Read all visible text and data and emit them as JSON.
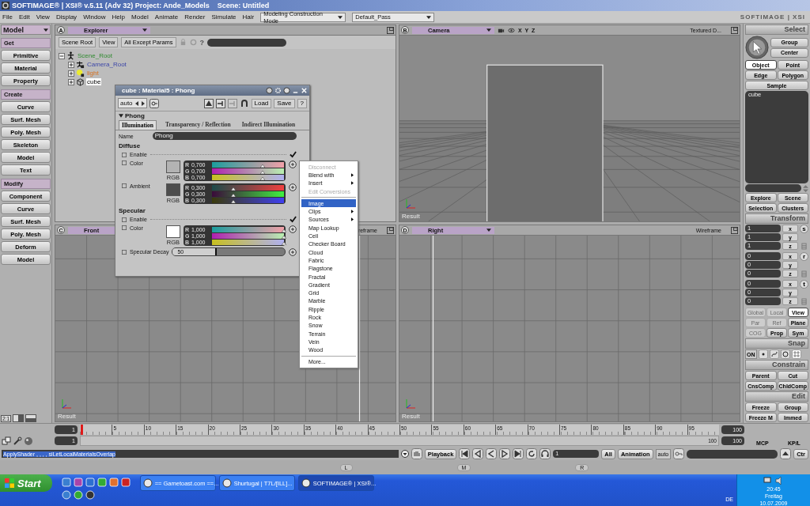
{
  "window": {
    "title": "SOFTIMAGE® | XSI® v.5.11 (Adv 32) Project: Ande_Models    Scene: Untitled"
  },
  "menu_bar": {
    "items": [
      "File",
      "Edit",
      "View",
      "Display",
      "Window",
      "Help",
      "Model",
      "Animate",
      "Render",
      "Simulate",
      "Hair"
    ],
    "mode_dropdown": "Modeling Construction Mode",
    "pass_dropdown": "Default_Pass",
    "logo": "SOFTIMAGE | XSI"
  },
  "left_toolbar": {
    "mode": "Model",
    "sections": [
      {
        "title": "Get",
        "buttons": [
          "Primitive",
          "Material",
          "Property"
        ]
      },
      {
        "title": "Create",
        "buttons": [
          "Curve",
          "Surf. Mesh",
          "Poly. Mesh",
          "Skeleton",
          "Model",
          "Text"
        ]
      },
      {
        "title": "Modify",
        "buttons": [
          "Component",
          "Curve",
          "Surf. Mesh",
          "Poly. Mesh",
          "Deform",
          "Model"
        ]
      }
    ],
    "layout_label": "2:1"
  },
  "explorer": {
    "letter": "A",
    "title": "Explorer",
    "toolbar": [
      "Scene Root",
      "View",
      "All Except Params"
    ],
    "help": "?",
    "tree": [
      {
        "label": "Scene_Root",
        "kind": "root",
        "expanded": true,
        "selected": false,
        "children": [
          {
            "label": "Camera_Root",
            "kind": "camera",
            "expanded": false,
            "selected": false
          },
          {
            "label": "light",
            "kind": "light",
            "expanded": false,
            "selected": false
          },
          {
            "label": "cube",
            "kind": "mesh",
            "expanded": false,
            "selected": true
          }
        ]
      }
    ]
  },
  "viewports": [
    {
      "letter": "B",
      "title": "Camera",
      "kind": "perspective",
      "axes_label": "X Y Z",
      "mode": "Textured D...",
      "result_label": "Result"
    },
    {
      "letter": "C",
      "title": "Front",
      "kind": "ortho",
      "mode": "reframe",
      "result_label": "Result"
    },
    {
      "letter": "D",
      "title": "Right",
      "kind": "ortho",
      "mode": "Wireframe",
      "result_label": "Result"
    }
  ],
  "property_editor": {
    "title": "cube : Material5 : Phong",
    "preset": "auto",
    "load": "Load",
    "save": "Save",
    "help": "?",
    "section": "Phong",
    "tabs": [
      {
        "label": "Illumination",
        "selected": true
      },
      {
        "label": "Transparency / Reflection",
        "selected": false
      },
      {
        "label": "Indirect Illumination",
        "selected": false
      }
    ],
    "name_label": "Name",
    "name_value": "Phong",
    "groups": [
      {
        "title": "Diffuse",
        "enable_label": "Enable",
        "enabled": true,
        "params": [
          {
            "label": "Color",
            "rgb_label": "RGB",
            "channels": [
              {
                "label": "R",
                "value": "0,700",
                "level": 0.7
              },
              {
                "label": "G",
                "value": "0,700",
                "level": 0.7
              },
              {
                "label": "B",
                "value": "0,700",
                "level": 0.7
              }
            ]
          },
          {
            "label": "Ambient",
            "rgb_label": "RGB",
            "channels": [
              {
                "label": "R",
                "value": "0,300",
                "level": 0.3
              },
              {
                "label": "G",
                "value": "0,300",
                "level": 0.3
              },
              {
                "label": "B",
                "value": "0,300",
                "level": 0.3
              }
            ]
          }
        ]
      },
      {
        "title": "Specular",
        "enable_label": "Enable",
        "enabled": true,
        "params": [
          {
            "label": "Color",
            "rgb_label": "RGB",
            "channels": [
              {
                "label": "R",
                "value": "1,000",
                "level": 1
              },
              {
                "label": "G",
                "value": "1,000",
                "level": 1
              },
              {
                "label": "B",
                "value": "1,000",
                "level": 1
              }
            ]
          }
        ]
      }
    ],
    "decay": {
      "label": "Specular Decay",
      "value": "50",
      "level": 0.38
    }
  },
  "context_menu": [
    {
      "kind": "item",
      "label": "Disconnect",
      "disabled": true,
      "submenu": false,
      "selected": false
    },
    {
      "kind": "item",
      "label": "Blend with",
      "disabled": false,
      "submenu": true,
      "selected": false
    },
    {
      "kind": "item",
      "label": "Insert",
      "disabled": false,
      "submenu": true,
      "selected": false
    },
    {
      "kind": "item",
      "label": "Edit Conversions",
      "disabled": true,
      "submenu": false,
      "selected": false
    },
    {
      "kind": "separator"
    },
    {
      "kind": "item",
      "label": "Image",
      "disabled": false,
      "submenu": false,
      "selected": true
    },
    {
      "kind": "item",
      "label": "Clips",
      "disabled": false,
      "submenu": true,
      "selected": false
    },
    {
      "kind": "item",
      "label": "Sources",
      "disabled": false,
      "submenu": true,
      "selected": false
    },
    {
      "kind": "item",
      "label": "Map Lookup",
      "disabled": false,
      "submenu": false,
      "selected": false
    },
    {
      "kind": "item",
      "label": "Cell",
      "disabled": false,
      "submenu": false,
      "selected": false
    },
    {
      "kind": "item",
      "label": "Checker Board",
      "disabled": false,
      "submenu": false,
      "selected": false
    },
    {
      "kind": "item",
      "label": "Cloud",
      "disabled": false,
      "submenu": false,
      "selected": false
    },
    {
      "kind": "item",
      "label": "Fabric",
      "disabled": false,
      "submenu": false,
      "selected": false
    },
    {
      "kind": "item",
      "label": "Flagstone",
      "disabled": false,
      "submenu": false,
      "selected": false
    },
    {
      "kind": "item",
      "label": "Fractal",
      "disabled": false,
      "submenu": false,
      "selected": false
    },
    {
      "kind": "item",
      "label": "Gradient",
      "disabled": false,
      "submenu": false,
      "selected": false
    },
    {
      "kind": "item",
      "label": "Grid",
      "disabled": false,
      "submenu": false,
      "selected": false
    },
    {
      "kind": "item",
      "label": "Marble",
      "disabled": false,
      "submenu": false,
      "selected": false
    },
    {
      "kind": "item",
      "label": "Ripple",
      "disabled": false,
      "submenu": false,
      "selected": false
    },
    {
      "kind": "item",
      "label": "Rock",
      "disabled": false,
      "submenu": false,
      "selected": false
    },
    {
      "kind": "item",
      "label": "Snow",
      "disabled": false,
      "submenu": false,
      "selected": false
    },
    {
      "kind": "item",
      "label": "Terrain",
      "disabled": false,
      "submenu": false,
      "selected": false
    },
    {
      "kind": "item",
      "label": "Vein",
      "disabled": false,
      "submenu": false,
      "selected": false
    },
    {
      "kind": "item",
      "label": "Wood",
      "disabled": false,
      "submenu": false,
      "selected": false
    },
    {
      "kind": "separator"
    },
    {
      "kind": "item",
      "label": "More...",
      "disabled": false,
      "submenu": false,
      "selected": false
    }
  ],
  "select_panel": {
    "title": "Select",
    "top_buttons": [
      "Group",
      "Center"
    ],
    "filters": [
      {
        "label": "Object",
        "selected": true
      },
      {
        "label": "Point",
        "selected": false
      },
      {
        "label": "Edge",
        "selected": false
      },
      {
        "label": "Polygon",
        "selected": false
      }
    ],
    "sample": "Sample",
    "selection_field": "cube",
    "nav": [
      "Explore",
      "Scene",
      "Selection",
      "Clusters"
    ]
  },
  "transform_panel": {
    "title": "Transform",
    "groups": [
      {
        "key": "s",
        "fields": [
          {
            "axis": "x",
            "value": "1"
          },
          {
            "axis": "y",
            "value": "1"
          },
          {
            "axis": "z",
            "value": "1"
          }
        ]
      },
      {
        "key": "r",
        "fields": [
          {
            "axis": "x",
            "value": "0"
          },
          {
            "axis": "y",
            "value": "0"
          },
          {
            "axis": "z",
            "value": "0"
          }
        ]
      },
      {
        "key": "t",
        "fields": [
          {
            "axis": "x",
            "value": "0"
          },
          {
            "axis": "y",
            "value": "0"
          },
          {
            "axis": "z",
            "value": "0"
          }
        ]
      }
    ],
    "ref_buttons": [
      {
        "label": "Global",
        "selected": false,
        "disabled": true
      },
      {
        "label": "Local",
        "selected": false,
        "disabled": true
      },
      {
        "label": "View",
        "selected": true,
        "disabled": false
      },
      {
        "label": "Par",
        "selected": false,
        "disabled": true
      },
      {
        "label": "Ref",
        "selected": false,
        "disabled": true
      },
      {
        "label": "Plane",
        "selected": false,
        "disabled": false
      },
      {
        "label": "COG",
        "selected": false,
        "disabled": true
      },
      {
        "label": "Prop",
        "selected": false,
        "disabled": false
      },
      {
        "label": "Sym",
        "selected": false,
        "disabled": false
      }
    ]
  },
  "snap_panel": {
    "title": "Snap",
    "on_label": "ON"
  },
  "constrain_panel": {
    "title": "Constrain",
    "buttons": [
      "Parent",
      "Cut",
      "CnsComp",
      "ChldComp"
    ]
  },
  "edit_panel": {
    "title": "Edit",
    "buttons": [
      "Freeze",
      "Group",
      "Freeze M",
      "Immed"
    ]
  },
  "timeline": {
    "start": "1",
    "end": "100",
    "ticks": [
      "5",
      "10",
      "15",
      "20",
      "25",
      "30",
      "35",
      "40",
      "45",
      "50",
      "55",
      "60",
      "65",
      "70",
      "75",
      "80",
      "85",
      "90",
      "95"
    ],
    "range_start": "1",
    "range": {
      "level": 1,
      "label": "100"
    },
    "range_end": "100",
    "mcp": "MCP",
    "kpl": "KP/L"
  },
  "command_bar": {
    "command": "ApplyShader , , , , siLetLocalMaterialsOverlap",
    "playback": "Playback",
    "frame": "1",
    "all": "All",
    "animation": "Animation",
    "auto": "auto",
    "ctr": "Ctr"
  },
  "panel_tabs": [
    "L",
    "M",
    "R"
  ],
  "taskbar": {
    "start": "Start",
    "tasks": [
      {
        "label": "== Gametoast.com ==...",
        "selected": false
      },
      {
        "label": "Shurtugal | T7L/[ILL]...",
        "selected": false
      },
      {
        "label": "SOFTIMAGE® | XSI®...",
        "selected": true
      }
    ],
    "language": "DE",
    "time": "20:45",
    "day": "Freitag",
    "date": "10.07.2009"
  }
}
